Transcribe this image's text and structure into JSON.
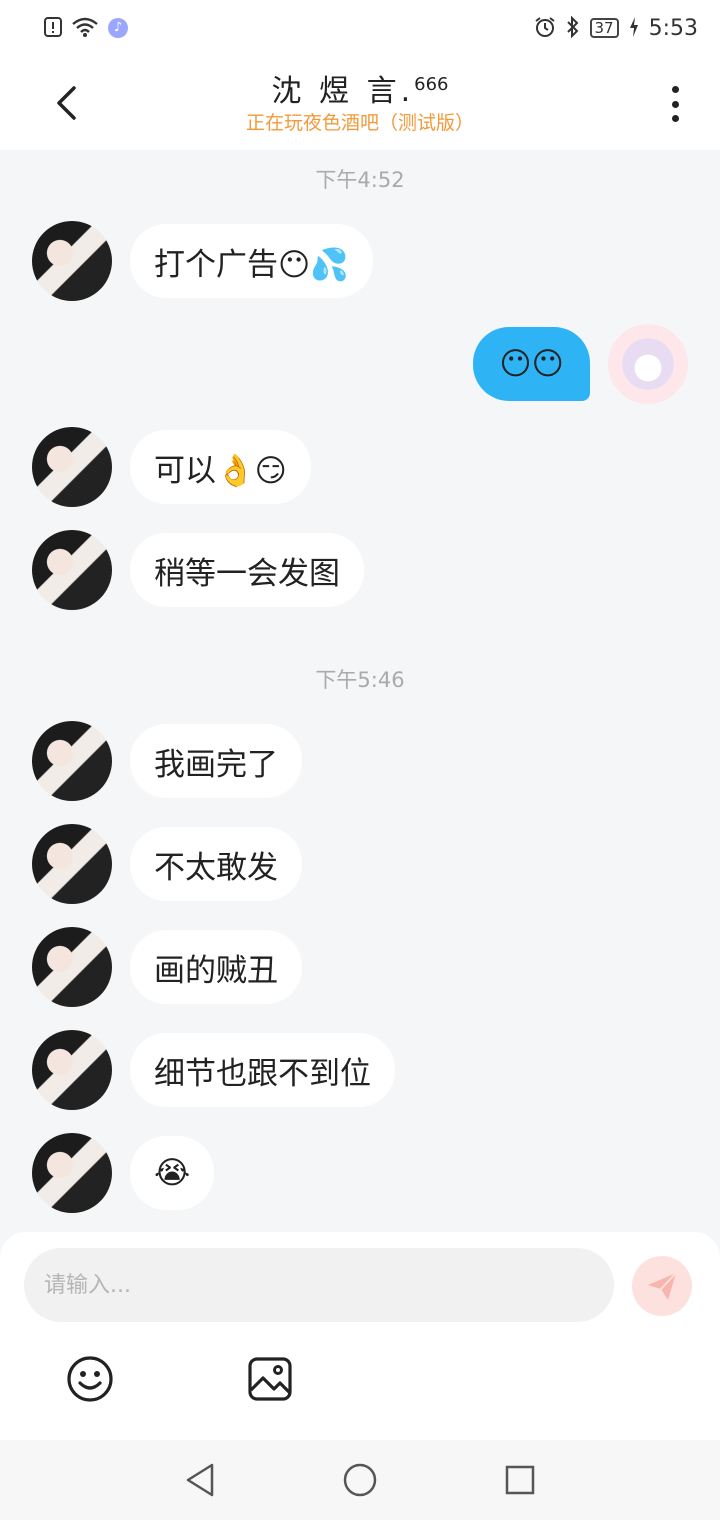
{
  "status_bar": {
    "time": "5:53",
    "battery": "37",
    "icons": [
      "alert-icon",
      "wifi-icon",
      "music-icon",
      "alarm-icon",
      "bluetooth-icon",
      "charging-icon"
    ]
  },
  "header": {
    "title": "沈 煜 言.",
    "title_sup": "666",
    "subtitle": "正在玩夜色酒吧（测试版）"
  },
  "messages": {
    "ts1": "下午4:52",
    "m1": "打个广告😶💦",
    "m2": "😶😶",
    "m3": "可以👌😏",
    "m4": "稍等一会发图",
    "ts2": "下午5:46",
    "m5": "我画完了",
    "m6": "不太敢发",
    "m7": "画的贼丑",
    "m8": "细节也跟不到位",
    "m9": "😭"
  },
  "composer": {
    "placeholder": "请输入...",
    "send_color": "#f4746a"
  },
  "colors": {
    "mine_bubble": "#2eb4f5",
    "theirs_bubble": "#ffffff",
    "subtitle": "#f29a3a",
    "background": "#f5f6f8"
  }
}
